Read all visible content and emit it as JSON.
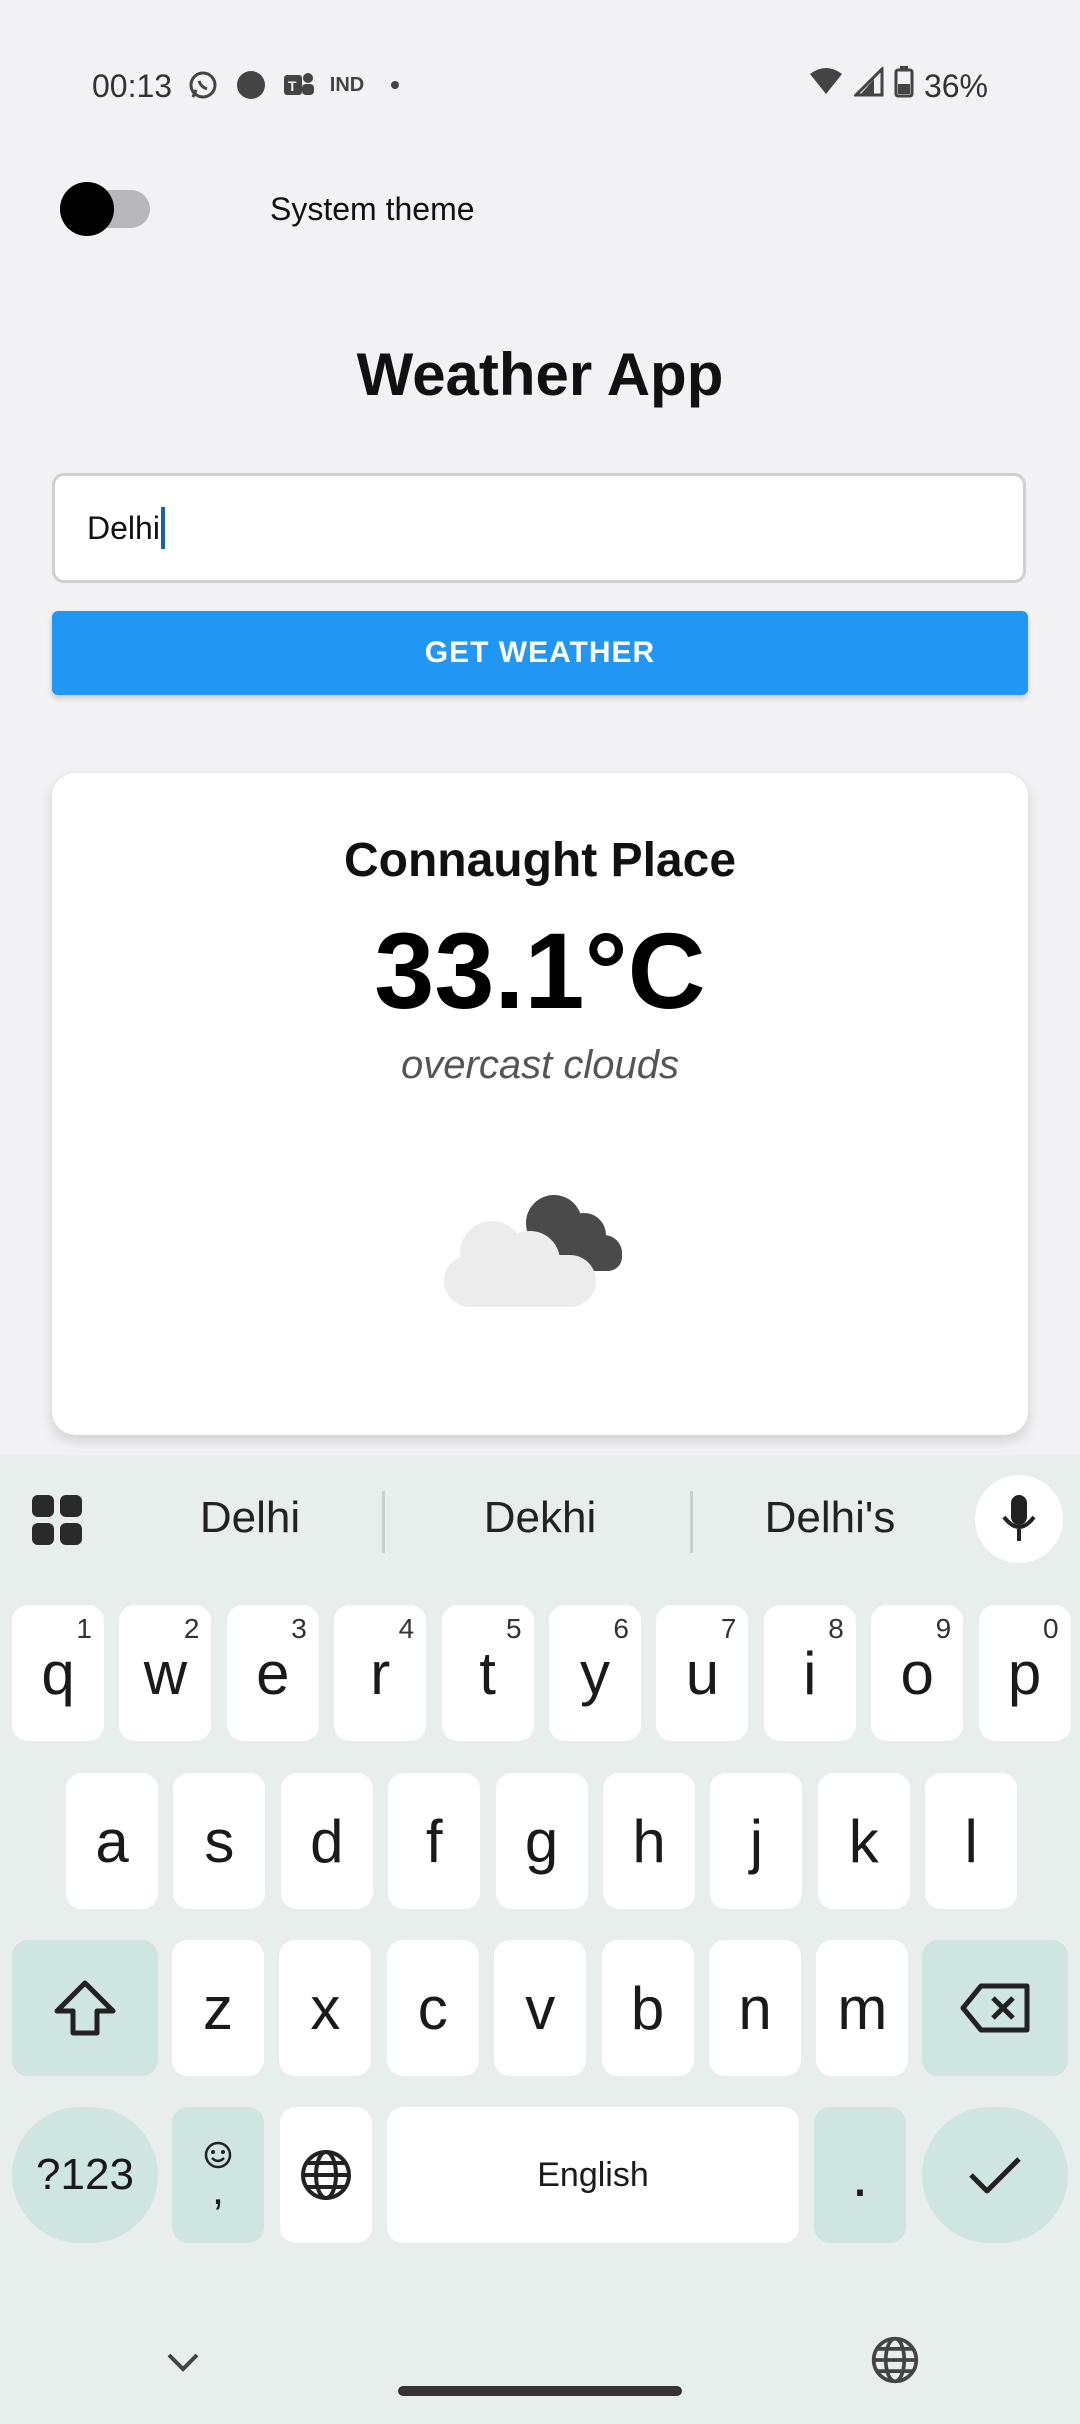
{
  "status_bar": {
    "time": "00:13",
    "icons_left": [
      "whatsapp-icon",
      "record-icon",
      "teams-icon",
      "ind-icon",
      "dot-icon"
    ],
    "ind_label": "IND",
    "battery": "36%"
  },
  "theme": {
    "label": "System theme",
    "enabled": false
  },
  "title": "Weather App",
  "search": {
    "value": "Delhi",
    "button_label": "GET WEATHER"
  },
  "weather": {
    "place": "Connaught Place",
    "temperature": "33.1°C",
    "description": "overcast clouds",
    "icon": "overcast-clouds-icon"
  },
  "keyboard": {
    "suggestions": [
      "Delhi",
      "Dekhi",
      "Delhi's"
    ],
    "row1": [
      {
        "k": "q",
        "h": "1"
      },
      {
        "k": "w",
        "h": "2"
      },
      {
        "k": "e",
        "h": "3"
      },
      {
        "k": "r",
        "h": "4"
      },
      {
        "k": "t",
        "h": "5"
      },
      {
        "k": "y",
        "h": "6"
      },
      {
        "k": "u",
        "h": "7"
      },
      {
        "k": "i",
        "h": "8"
      },
      {
        "k": "o",
        "h": "9"
      },
      {
        "k": "p",
        "h": "0"
      }
    ],
    "row2": [
      "a",
      "s",
      "d",
      "f",
      "g",
      "h",
      "j",
      "k",
      "l"
    ],
    "row3": [
      "z",
      "x",
      "c",
      "v",
      "b",
      "n",
      "m"
    ],
    "symbols_label": "?123",
    "comma_label": ",",
    "space_label": "English",
    "period_label": "."
  },
  "colors": {
    "accent": "#2196f3",
    "keyboard_bg": "#e8eeec",
    "mod_key": "#cfe5df"
  }
}
